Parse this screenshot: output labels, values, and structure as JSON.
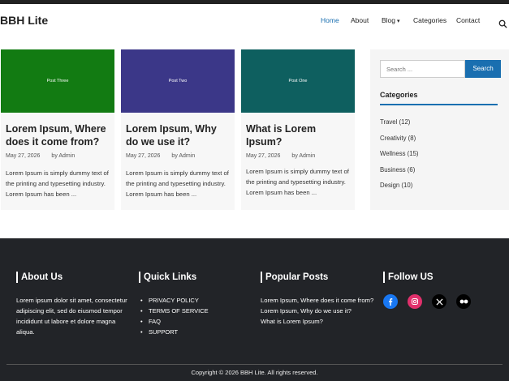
{
  "site": {
    "brand": "BBH Lite"
  },
  "nav": {
    "items": [
      {
        "label": "Home",
        "active": true
      },
      {
        "label": "About"
      },
      {
        "label": "Blog",
        "caret": "▾"
      },
      {
        "label": "Categories"
      },
      {
        "label": "Contact"
      }
    ],
    "search_icon": "search-icon"
  },
  "posts": [
    {
      "thumb_label": "Post Three",
      "thumb_color": "#127b12",
      "title": "Lorem Ipsum, Where does it come from?",
      "date": "May 27, 2026",
      "author": "by Admin",
      "excerpt": "Lorem Ipsum is simply dummy text of the printing and typesetting industry. Lorem Ipsum has been ..."
    },
    {
      "thumb_label": "Post Two",
      "thumb_color": "#3b3788",
      "title": "Lorem Ipsum, Why do we use it?",
      "date": "May 27, 2026",
      "author": "by Admin",
      "excerpt": "Lorem Ipsum is simply dummy text of the printing and typesetting industry. Lorem Ipsum has been ..."
    },
    {
      "thumb_label": "Post One",
      "thumb_color": "#0e5f5f",
      "title": "What is Lorem Ipsum?",
      "date": "May 27, 2026",
      "author": "by Admin",
      "excerpt": "Lorem Ipsum is simply dummy text of the printing and typesetting industry. Lorem Ipsum has been ..."
    }
  ],
  "sidebar": {
    "search_placeholder": "Search ...",
    "search_button": "Search",
    "categories_heading": "Categories",
    "categories": [
      "Travel (12)",
      "Creativity (8)",
      "Wellness (15)",
      "Business (6)",
      "Design (10)"
    ]
  },
  "footer": {
    "about": {
      "heading": "About Us",
      "text": "Lorem ipsum dolor sit amet, consectetur adipiscing elit, sed do eiusmod tempor incididunt ut labore et dolore magna aliqua."
    },
    "quick_links": {
      "heading": "Quick Links",
      "items": [
        "PRIVACY POLICY",
        "TERMS OF SERVICE",
        "FAQ",
        "SUPPORT"
      ]
    },
    "popular": {
      "heading": "Popular Posts",
      "items": [
        "Lorem Ipsum, Where does it come from?",
        "Lorem Ipsum, Why do we use it?",
        "What is Lorem Ipsum?"
      ]
    },
    "follow": {
      "heading": "Follow US",
      "icons": [
        "facebook-icon",
        "instagram-icon",
        "x-icon",
        "flickr-icon"
      ]
    },
    "copyright": "Copyright © 2026 BBH Lite. All rights reserved."
  },
  "colors": {
    "accent": "#1a6fb0",
    "footer_bg": "#222428"
  }
}
